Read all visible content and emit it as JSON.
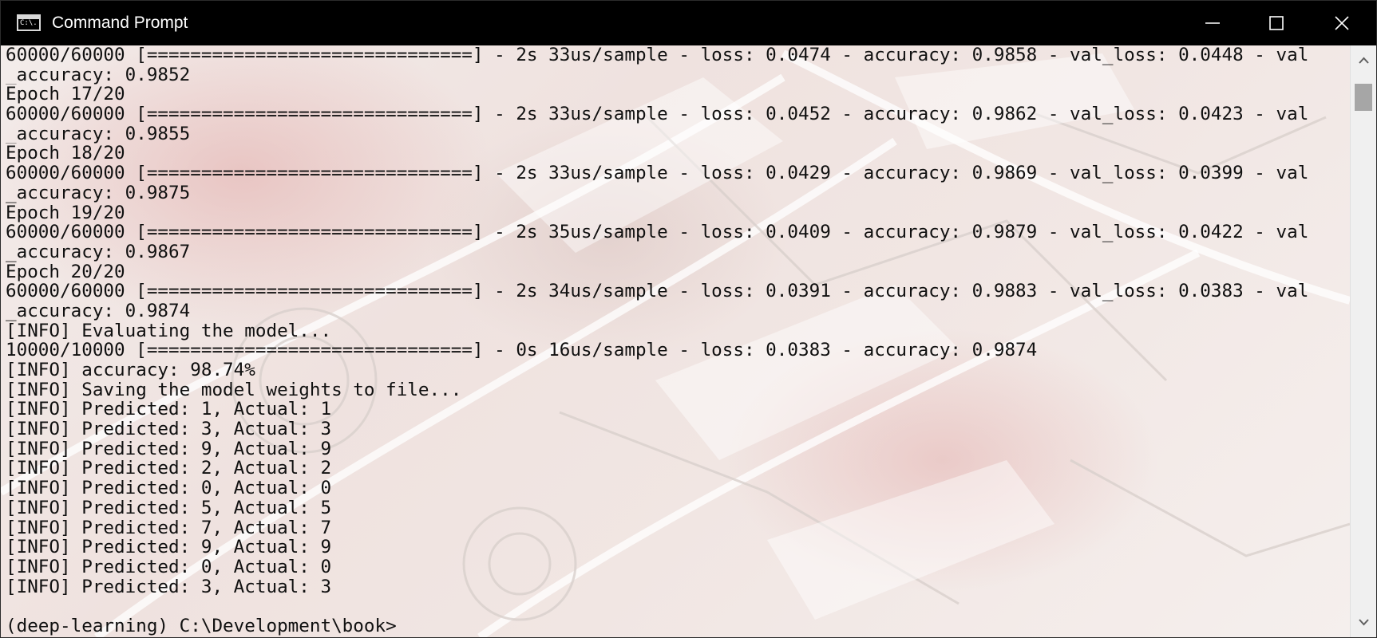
{
  "window": {
    "title": "Command Prompt",
    "icon_text": "C:\\.",
    "icons": {
      "app": "console-app-icon",
      "minimize": "minimize-icon",
      "maximize": "maximize-icon",
      "close": "close-icon",
      "scroll_up": "chevron-up-icon",
      "scroll_down": "chevron-down-icon"
    },
    "colors": {
      "titlebar": "#000000",
      "title_text": "#ffffff",
      "console_text": "#101010",
      "scrollbar_track": "#f0f0f0",
      "scrollbar_thumb": "#a6a6a6"
    }
  },
  "console": {
    "lines": [
      "60000/60000 [==============================] - 2s 33us/sample - loss: 0.0474 - accuracy: 0.9858 - val_loss: 0.0448 - val",
      "_accuracy: 0.9852",
      "Epoch 17/20",
      "60000/60000 [==============================] - 2s 33us/sample - loss: 0.0452 - accuracy: 0.9862 - val_loss: 0.0423 - val",
      "_accuracy: 0.9855",
      "Epoch 18/20",
      "60000/60000 [==============================] - 2s 33us/sample - loss: 0.0429 - accuracy: 0.9869 - val_loss: 0.0399 - val",
      "_accuracy: 0.9875",
      "Epoch 19/20",
      "60000/60000 [==============================] - 2s 35us/sample - loss: 0.0409 - accuracy: 0.9879 - val_loss: 0.0422 - val",
      "_accuracy: 0.9867",
      "Epoch 20/20",
      "60000/60000 [==============================] - 2s 34us/sample - loss: 0.0391 - accuracy: 0.9883 - val_loss: 0.0383 - val",
      "_accuracy: 0.9874",
      "[INFO] Evaluating the model...",
      "10000/10000 [==============================] - 0s 16us/sample - loss: 0.0383 - accuracy: 0.9874",
      "[INFO] accuracy: 98.74%",
      "[INFO] Saving the model weights to file...",
      "[INFO] Predicted: 1, Actual: 1",
      "[INFO] Predicted: 3, Actual: 3",
      "[INFO] Predicted: 9, Actual: 9",
      "[INFO] Predicted: 2, Actual: 2",
      "[INFO] Predicted: 0, Actual: 0",
      "[INFO] Predicted: 5, Actual: 5",
      "[INFO] Predicted: 7, Actual: 7",
      "[INFO] Predicted: 9, Actual: 9",
      "[INFO] Predicted: 0, Actual: 0",
      "[INFO] Predicted: 3, Actual: 3"
    ],
    "prompt": "(deep-learning) C:\\Development\\book>"
  }
}
